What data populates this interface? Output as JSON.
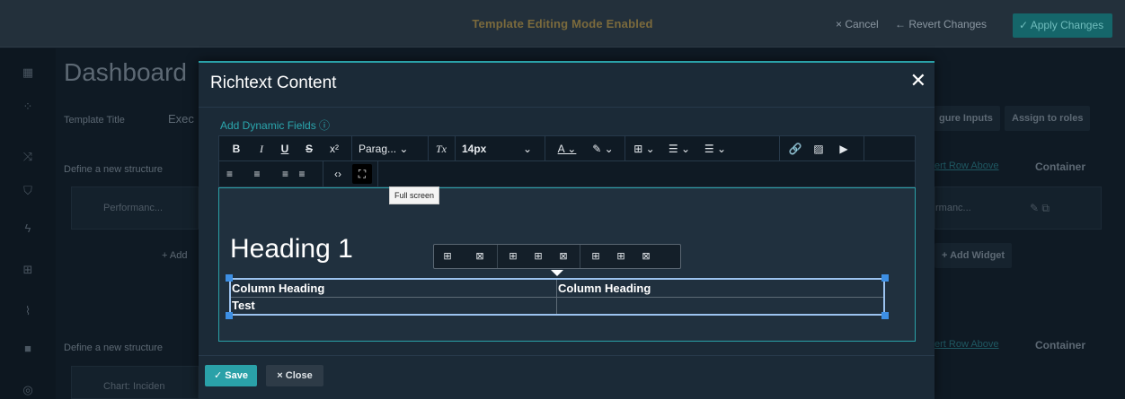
{
  "topbar": {
    "mode_text": "Template Editing Mode Enabled",
    "cancel_label": "× Cancel",
    "revert_label": "← Revert Changes",
    "apply_label": "✓ Apply Changes"
  },
  "background": {
    "page_title": "Dashboard",
    "template_title_label": "Template Title",
    "template_title_value": "Exec",
    "configure_inputs": "gure Inputs",
    "assign_roles": "Assign to roles",
    "define_structure": "Define a new structure",
    "insert_row_above": "ert Row Above",
    "container_label": "Container",
    "widget_left": "Performanc...",
    "widget_right": "rmanc...",
    "add_left": "+ Add",
    "add_widget": "+ Add Widget",
    "chart_widget": "Chart: Inciden"
  },
  "modal": {
    "title": "Richtext Content",
    "close_icon": "✕",
    "dynamic_fields_label": "Add Dynamic Fields ⓘ",
    "toolbar": {
      "bold": "B",
      "italic": "I",
      "underline": "U",
      "strike": "S",
      "superscript": "x²",
      "block_format": "Parag... ⌄",
      "clear_format": "Tx",
      "font_size": "14px",
      "font_size_chevron": "⌄",
      "text_color": "A ⌄",
      "highlight": "✎ ⌄",
      "table": "⊞ ⌄",
      "bullet_list": "☰ ⌄",
      "numbered_list": "☰ ⌄",
      "link": "🔗",
      "image": "▨",
      "media": "▶",
      "align_left": "≡",
      "align_center": "≡",
      "align_right": "≡",
      "align_justify": "≡",
      "code": "‹›",
      "fullscreen": "⛶"
    },
    "tooltip": "Full screen",
    "content": {
      "heading": "Heading 1",
      "table": {
        "header": [
          "Column Heading",
          "Column Heading"
        ],
        "rows": [
          [
            "Test",
            ""
          ]
        ]
      }
    },
    "footer": {
      "save_label": "✓ Save",
      "close_label": "× Close"
    }
  }
}
